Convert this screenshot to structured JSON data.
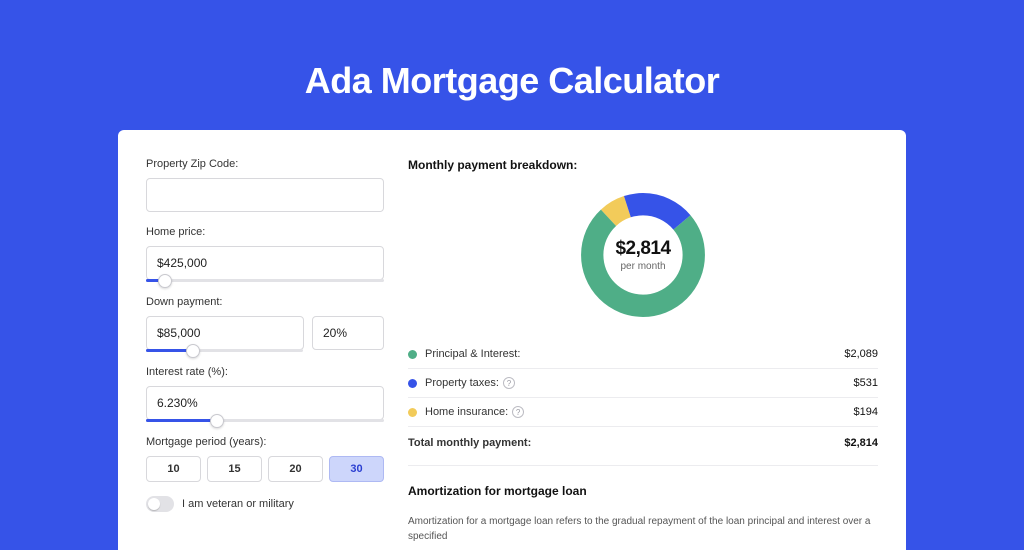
{
  "title": "Ada Mortgage Calculator",
  "colors": {
    "green": "#4fae87",
    "blue": "#3653e8",
    "yellow": "#f2cb5a"
  },
  "form": {
    "zip": {
      "label": "Property Zip Code:",
      "value": ""
    },
    "home_price": {
      "label": "Home price:",
      "value": "$425,000",
      "slider_pct": 8
    },
    "down_payment": {
      "label": "Down payment:",
      "value": "$85,000",
      "pct": "20%",
      "slider_pct": 20
    },
    "interest": {
      "label": "Interest rate (%):",
      "value": "6.230%",
      "slider_pct": 30
    },
    "period": {
      "label": "Mortgage period (years):",
      "options": [
        "10",
        "15",
        "20",
        "30"
      ],
      "selected": "30"
    },
    "veteran": {
      "label": "I am veteran or military",
      "on": false
    }
  },
  "breakdown": {
    "heading": "Monthly payment breakdown:",
    "total_amount": "$2,814",
    "total_sub": "per month",
    "items": [
      {
        "key": "pi",
        "label": "Principal & Interest:",
        "value": "$2,089",
        "color": "#4fae87",
        "info": false
      },
      {
        "key": "tax",
        "label": "Property taxes:",
        "value": "$531",
        "color": "#3653e8",
        "info": true
      },
      {
        "key": "ins",
        "label": "Home insurance:",
        "value": "$194",
        "color": "#f2cb5a",
        "info": true
      }
    ],
    "total_row": {
      "label": "Total monthly payment:",
      "value": "$2,814"
    }
  },
  "chart_data": {
    "type": "pie",
    "title": "Monthly payment breakdown",
    "series": [
      {
        "name": "Principal & Interest",
        "value": 2089,
        "color": "#4fae87"
      },
      {
        "name": "Property taxes",
        "value": 531,
        "color": "#3653e8"
      },
      {
        "name": "Home insurance",
        "value": 194,
        "color": "#f2cb5a"
      }
    ],
    "total": 2814,
    "center_label": "$2,814",
    "center_sub": "per month"
  },
  "amortization": {
    "heading": "Amortization for mortgage loan",
    "text": "Amortization for a mortgage loan refers to the gradual repayment of the loan principal and interest over a specified"
  }
}
